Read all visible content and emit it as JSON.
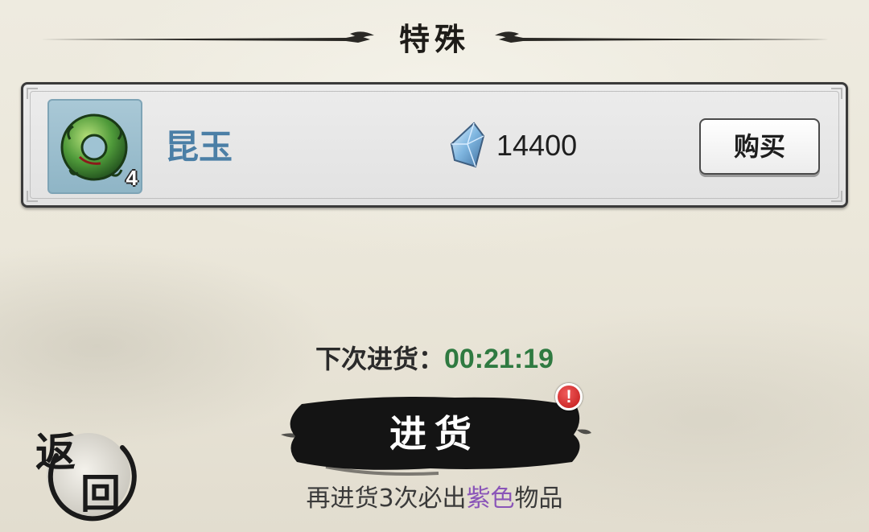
{
  "section": {
    "title": "特殊"
  },
  "item": {
    "name": "昆玉",
    "count": "4",
    "icon": "jade-ring-icon",
    "price": "14400",
    "currency_icon": "crystal-icon",
    "buy_label": "购买"
  },
  "restock": {
    "label": "下次进货：",
    "timer": "00:21:19",
    "button_label": "进货",
    "alert_badge": "!"
  },
  "guarantee": {
    "prefix": "再进货3次必出",
    "highlight": "紫色",
    "suffix": "物品"
  },
  "back": {
    "char1": "返",
    "char2": "回"
  },
  "colors": {
    "item_name": "#4b7fa6",
    "timer": "#2f7a41",
    "highlight": "#8a55b8",
    "alert": "#c01818"
  }
}
